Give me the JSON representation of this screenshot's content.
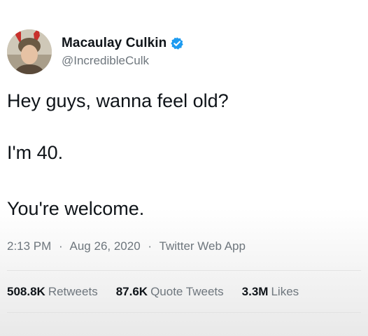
{
  "author": {
    "display_name": "Macaulay Culkin",
    "handle": "@IncredibleCulk",
    "verified": true,
    "avatar": "profile-photo-bunny-ears"
  },
  "tweet": {
    "lines": [
      "Hey guys, wanna feel old?",
      "I'm 40.",
      "You're welcome."
    ]
  },
  "meta": {
    "time": "2:13 PM",
    "sep1": "·",
    "date": "Aug 26, 2020",
    "sep2": "·",
    "source": "Twitter Web App"
  },
  "stats": [
    {
      "value": "508.8K",
      "label": "Retweets"
    },
    {
      "value": "87.6K",
      "label": "Quote Tweets"
    },
    {
      "value": "3.3M",
      "label": "Likes"
    }
  ],
  "colors": {
    "verified_blue": "#1d9bf0",
    "secondary_text": "#6e767d",
    "primary_text": "#0f1419"
  }
}
